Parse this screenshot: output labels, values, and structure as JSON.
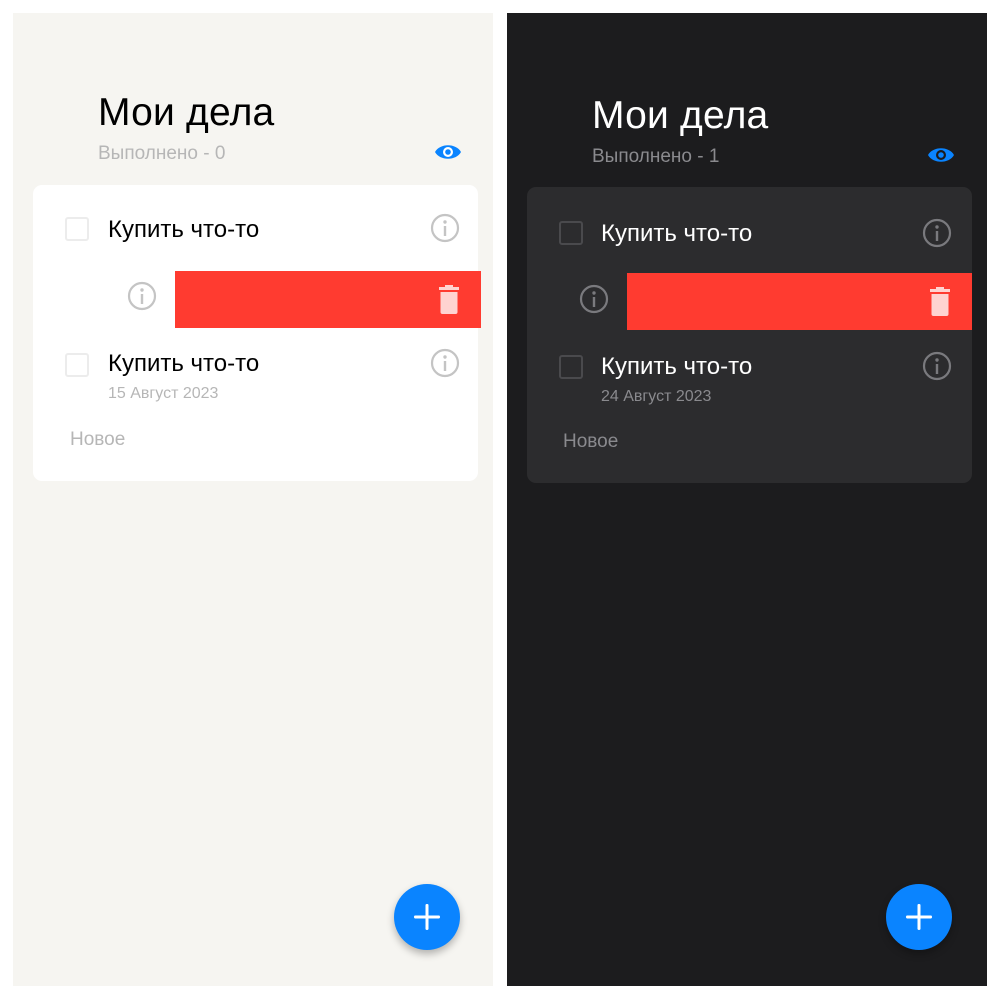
{
  "colors": {
    "accent": "#0a84ff",
    "delete": "#ff3b30",
    "light_background": "#f6f5f1",
    "dark_background": "#1c1c1e"
  },
  "icons": {
    "visibility": "eye-icon",
    "details": "info-icon",
    "delete": "trash-icon",
    "add": "plus-icon"
  },
  "light": {
    "title": "Мои дела",
    "done_text": "Выполнено - 0",
    "tasks": [
      {
        "text": "Купить что-то",
        "date": ""
      },
      {
        "text": "",
        "date": "",
        "swiped": true
      },
      {
        "text": "Купить что-то",
        "date": "15 Август 2023"
      }
    ],
    "new_label": "Новое"
  },
  "dark": {
    "title": "Мои дела",
    "done_text": "Выполнено - 1",
    "tasks": [
      {
        "text": "Купить что-то",
        "date": ""
      },
      {
        "text": "",
        "date": "",
        "swiped": true
      },
      {
        "text": "Купить что-то",
        "date": "24 Август 2023"
      }
    ],
    "new_label": "Новое"
  }
}
